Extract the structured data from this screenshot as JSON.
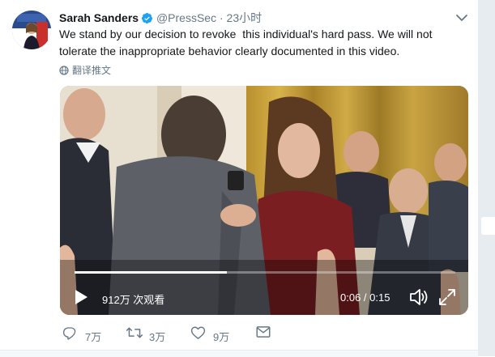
{
  "tweet": {
    "name": "Sarah Sanders",
    "handle": "@PressSec",
    "separator": "·",
    "time": "23小时",
    "text_line1": "We stand by our decision to revoke  this individual's hard pass. We will not",
    "text_line2": "tolerate the inappropriate behavior clearly documented in this video.",
    "translate_label": "翻译推文"
  },
  "video": {
    "views": "912万 次观看",
    "time": "0:06 / 0:15",
    "progress": 0.4
  },
  "actions": {
    "reply_count": "7万",
    "retweet_count": "3万",
    "like_count": "9万"
  },
  "icons": {
    "verified": "verified-badge-icon",
    "caret": "chevron-down-icon",
    "globe": "globe-icon",
    "play": "play-icon",
    "volume": "volume-icon",
    "fullscreen": "fullscreen-icon",
    "reply": "reply-icon",
    "retweet": "retweet-icon",
    "like": "heart-icon",
    "dm": "envelope-icon"
  },
  "colors": {
    "verified": "#1da1f2",
    "secondary_text": "#657786",
    "primary_text": "#14171a"
  }
}
